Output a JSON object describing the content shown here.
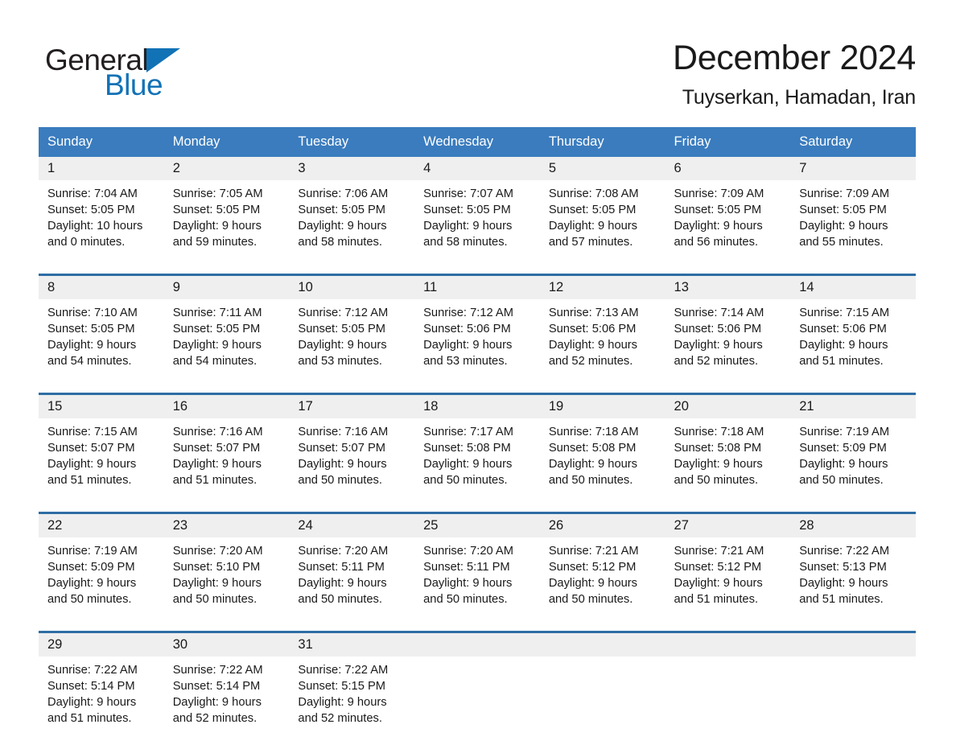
{
  "logo": {
    "word_1": "General",
    "word_2": "Blue",
    "triangle": "blue-triangle-icon",
    "colors": {
      "accent": "#1272b6",
      "dark": "#231f20"
    }
  },
  "header": {
    "title": "December 2024",
    "subtitle": "Tuyserkan, Hamadan, Iran"
  },
  "calendar": {
    "colors": {
      "header_bg": "#3a7cbe",
      "header_text": "#ffffff",
      "date_bg": "#efefef",
      "separator": "#2e6da4",
      "body_text": "#1a1a1a"
    },
    "weekday_headers": [
      "Sunday",
      "Monday",
      "Tuesday",
      "Wednesday",
      "Thursday",
      "Friday",
      "Saturday"
    ],
    "weeks": [
      [
        {
          "day": "1",
          "sunrise": "Sunrise: 7:04 AM",
          "sunset": "Sunset: 5:05 PM",
          "daylight_1": "Daylight: 10 hours",
          "daylight_2": "and 0 minutes."
        },
        {
          "day": "2",
          "sunrise": "Sunrise: 7:05 AM",
          "sunset": "Sunset: 5:05 PM",
          "daylight_1": "Daylight: 9 hours",
          "daylight_2": "and 59 minutes."
        },
        {
          "day": "3",
          "sunrise": "Sunrise: 7:06 AM",
          "sunset": "Sunset: 5:05 PM",
          "daylight_1": "Daylight: 9 hours",
          "daylight_2": "and 58 minutes."
        },
        {
          "day": "4",
          "sunrise": "Sunrise: 7:07 AM",
          "sunset": "Sunset: 5:05 PM",
          "daylight_1": "Daylight: 9 hours",
          "daylight_2": "and 58 minutes."
        },
        {
          "day": "5",
          "sunrise": "Sunrise: 7:08 AM",
          "sunset": "Sunset: 5:05 PM",
          "daylight_1": "Daylight: 9 hours",
          "daylight_2": "and 57 minutes."
        },
        {
          "day": "6",
          "sunrise": "Sunrise: 7:09 AM",
          "sunset": "Sunset: 5:05 PM",
          "daylight_1": "Daylight: 9 hours",
          "daylight_2": "and 56 minutes."
        },
        {
          "day": "7",
          "sunrise": "Sunrise: 7:09 AM",
          "sunset": "Sunset: 5:05 PM",
          "daylight_1": "Daylight: 9 hours",
          "daylight_2": "and 55 minutes."
        }
      ],
      [
        {
          "day": "8",
          "sunrise": "Sunrise: 7:10 AM",
          "sunset": "Sunset: 5:05 PM",
          "daylight_1": "Daylight: 9 hours",
          "daylight_2": "and 54 minutes."
        },
        {
          "day": "9",
          "sunrise": "Sunrise: 7:11 AM",
          "sunset": "Sunset: 5:05 PM",
          "daylight_1": "Daylight: 9 hours",
          "daylight_2": "and 54 minutes."
        },
        {
          "day": "10",
          "sunrise": "Sunrise: 7:12 AM",
          "sunset": "Sunset: 5:05 PM",
          "daylight_1": "Daylight: 9 hours",
          "daylight_2": "and 53 minutes."
        },
        {
          "day": "11",
          "sunrise": "Sunrise: 7:12 AM",
          "sunset": "Sunset: 5:06 PM",
          "daylight_1": "Daylight: 9 hours",
          "daylight_2": "and 53 minutes."
        },
        {
          "day": "12",
          "sunrise": "Sunrise: 7:13 AM",
          "sunset": "Sunset: 5:06 PM",
          "daylight_1": "Daylight: 9 hours",
          "daylight_2": "and 52 minutes."
        },
        {
          "day": "13",
          "sunrise": "Sunrise: 7:14 AM",
          "sunset": "Sunset: 5:06 PM",
          "daylight_1": "Daylight: 9 hours",
          "daylight_2": "and 52 minutes."
        },
        {
          "day": "14",
          "sunrise": "Sunrise: 7:15 AM",
          "sunset": "Sunset: 5:06 PM",
          "daylight_1": "Daylight: 9 hours",
          "daylight_2": "and 51 minutes."
        }
      ],
      [
        {
          "day": "15",
          "sunrise": "Sunrise: 7:15 AM",
          "sunset": "Sunset: 5:07 PM",
          "daylight_1": "Daylight: 9 hours",
          "daylight_2": "and 51 minutes."
        },
        {
          "day": "16",
          "sunrise": "Sunrise: 7:16 AM",
          "sunset": "Sunset: 5:07 PM",
          "daylight_1": "Daylight: 9 hours",
          "daylight_2": "and 51 minutes."
        },
        {
          "day": "17",
          "sunrise": "Sunrise: 7:16 AM",
          "sunset": "Sunset: 5:07 PM",
          "daylight_1": "Daylight: 9 hours",
          "daylight_2": "and 50 minutes."
        },
        {
          "day": "18",
          "sunrise": "Sunrise: 7:17 AM",
          "sunset": "Sunset: 5:08 PM",
          "daylight_1": "Daylight: 9 hours",
          "daylight_2": "and 50 minutes."
        },
        {
          "day": "19",
          "sunrise": "Sunrise: 7:18 AM",
          "sunset": "Sunset: 5:08 PM",
          "daylight_1": "Daylight: 9 hours",
          "daylight_2": "and 50 minutes."
        },
        {
          "day": "20",
          "sunrise": "Sunrise: 7:18 AM",
          "sunset": "Sunset: 5:08 PM",
          "daylight_1": "Daylight: 9 hours",
          "daylight_2": "and 50 minutes."
        },
        {
          "day": "21",
          "sunrise": "Sunrise: 7:19 AM",
          "sunset": "Sunset: 5:09 PM",
          "daylight_1": "Daylight: 9 hours",
          "daylight_2": "and 50 minutes."
        }
      ],
      [
        {
          "day": "22",
          "sunrise": "Sunrise: 7:19 AM",
          "sunset": "Sunset: 5:09 PM",
          "daylight_1": "Daylight: 9 hours",
          "daylight_2": "and 50 minutes."
        },
        {
          "day": "23",
          "sunrise": "Sunrise: 7:20 AM",
          "sunset": "Sunset: 5:10 PM",
          "daylight_1": "Daylight: 9 hours",
          "daylight_2": "and 50 minutes."
        },
        {
          "day": "24",
          "sunrise": "Sunrise: 7:20 AM",
          "sunset": "Sunset: 5:11 PM",
          "daylight_1": "Daylight: 9 hours",
          "daylight_2": "and 50 minutes."
        },
        {
          "day": "25",
          "sunrise": "Sunrise: 7:20 AM",
          "sunset": "Sunset: 5:11 PM",
          "daylight_1": "Daylight: 9 hours",
          "daylight_2": "and 50 minutes."
        },
        {
          "day": "26",
          "sunrise": "Sunrise: 7:21 AM",
          "sunset": "Sunset: 5:12 PM",
          "daylight_1": "Daylight: 9 hours",
          "daylight_2": "and 50 minutes."
        },
        {
          "day": "27",
          "sunrise": "Sunrise: 7:21 AM",
          "sunset": "Sunset: 5:12 PM",
          "daylight_1": "Daylight: 9 hours",
          "daylight_2": "and 51 minutes."
        },
        {
          "day": "28",
          "sunrise": "Sunrise: 7:22 AM",
          "sunset": "Sunset: 5:13 PM",
          "daylight_1": "Daylight: 9 hours",
          "daylight_2": "and 51 minutes."
        }
      ],
      [
        {
          "day": "29",
          "sunrise": "Sunrise: 7:22 AM",
          "sunset": "Sunset: 5:14 PM",
          "daylight_1": "Daylight: 9 hours",
          "daylight_2": "and 51 minutes."
        },
        {
          "day": "30",
          "sunrise": "Sunrise: 7:22 AM",
          "sunset": "Sunset: 5:14 PM",
          "daylight_1": "Daylight: 9 hours",
          "daylight_2": "and 52 minutes."
        },
        {
          "day": "31",
          "sunrise": "Sunrise: 7:22 AM",
          "sunset": "Sunset: 5:15 PM",
          "daylight_1": "Daylight: 9 hours",
          "daylight_2": "and 52 minutes."
        },
        {
          "day": "",
          "sunrise": "",
          "sunset": "",
          "daylight_1": "",
          "daylight_2": ""
        },
        {
          "day": "",
          "sunrise": "",
          "sunset": "",
          "daylight_1": "",
          "daylight_2": ""
        },
        {
          "day": "",
          "sunrise": "",
          "sunset": "",
          "daylight_1": "",
          "daylight_2": ""
        },
        {
          "day": "",
          "sunrise": "",
          "sunset": "",
          "daylight_1": "",
          "daylight_2": ""
        }
      ]
    ]
  }
}
